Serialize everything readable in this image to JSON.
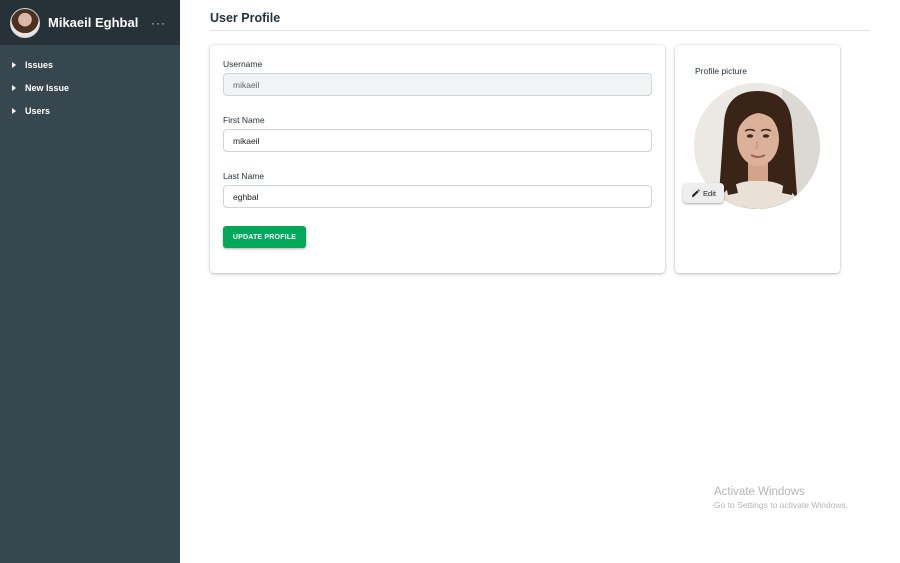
{
  "sidebar": {
    "user_name": "Mikaeil Eghbal",
    "menu_icon": "more-horizontal-icon",
    "more_label": "···",
    "items": [
      {
        "label": "Issues"
      },
      {
        "label": "New Issue"
      },
      {
        "label": "Users"
      }
    ]
  },
  "main": {
    "title": "User Profile",
    "form": {
      "username_label": "Username",
      "username_value": "mikaeil",
      "first_name_label": "First Name",
      "first_name_value": "mikaeil",
      "last_name_label": "Last Name",
      "last_name_value": "eghbal",
      "update_button": "UPDATE PROFILE"
    },
    "picture": {
      "label": "Profile picture",
      "edit_button": "Edit"
    }
  },
  "watermark": {
    "title": "Activate Windows",
    "subtitle": "Go to Settings to activate Windows."
  },
  "colors": {
    "sidebar_bg": "#37474f",
    "sidebar_header_bg": "#263238",
    "accent_green": "#00a859"
  }
}
